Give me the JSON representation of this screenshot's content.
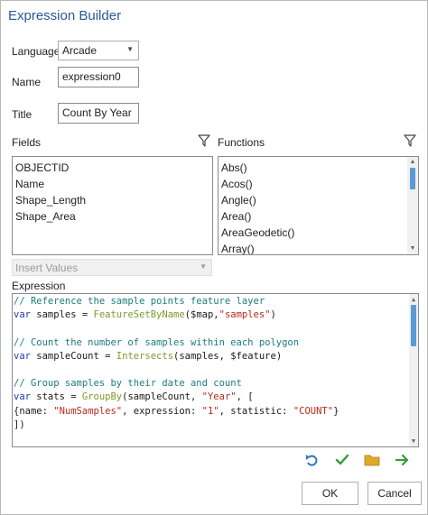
{
  "window": {
    "title": "Expression Builder"
  },
  "form": {
    "language_label": "Language",
    "language_value": "Arcade",
    "name_label": "Name",
    "name_value": "expression0",
    "title_label": "Title",
    "title_value": "Count By Year"
  },
  "fields": {
    "label": "Fields",
    "items": [
      "OBJECTID",
      "Name",
      "Shape_Length",
      "Shape_Area"
    ]
  },
  "functions": {
    "label": "Functions",
    "items": [
      "Abs()",
      "Acos()",
      "Angle()",
      "Area()",
      "AreaGeodetic()",
      "Array()"
    ]
  },
  "insert_values": {
    "label": "Insert Values"
  },
  "expression": {
    "label": "Expression",
    "lines": [
      [
        {
          "t": "// Reference the sample points feature layer",
          "c": "c-com"
        }
      ],
      [
        {
          "t": "var",
          "c": "c-kw"
        },
        {
          "t": " samples = ",
          "c": "c-var"
        },
        {
          "t": "FeatureSetByName",
          "c": "c-fn"
        },
        {
          "t": "(",
          "c": "c-var"
        },
        {
          "t": "$map",
          "c": "c-var"
        },
        {
          "t": ",",
          "c": "c-var"
        },
        {
          "t": "\"samples\"",
          "c": "c-str"
        },
        {
          "t": ")",
          "c": "c-var"
        }
      ],
      [],
      [
        {
          "t": "// Count the number of samples within each polygon",
          "c": "c-com"
        }
      ],
      [
        {
          "t": "var",
          "c": "c-kw"
        },
        {
          "t": " sampleCount = ",
          "c": "c-var"
        },
        {
          "t": "Intersects",
          "c": "c-fn"
        },
        {
          "t": "(samples, ",
          "c": "c-var"
        },
        {
          "t": "$feature",
          "c": "c-var"
        },
        {
          "t": ")",
          "c": "c-var"
        }
      ],
      [],
      [
        {
          "t": "// Group samples by their date and count",
          "c": "c-com"
        }
      ],
      [
        {
          "t": "var",
          "c": "c-kw"
        },
        {
          "t": " stats = ",
          "c": "c-var"
        },
        {
          "t": "GroupBy",
          "c": "c-fn"
        },
        {
          "t": "(sampleCount, ",
          "c": "c-var"
        },
        {
          "t": "\"Year\"",
          "c": "c-str"
        },
        {
          "t": ", [",
          "c": "c-var"
        }
      ],
      [
        {
          "t": "{name: ",
          "c": "c-var"
        },
        {
          "t": "\"NumSamples\"",
          "c": "c-str"
        },
        {
          "t": ", expression: ",
          "c": "c-var"
        },
        {
          "t": "\"1\"",
          "c": "c-str"
        },
        {
          "t": ", statistic: ",
          "c": "c-var"
        },
        {
          "t": "\"COUNT\"",
          "c": "c-str"
        },
        {
          "t": "}",
          "c": "c-var"
        }
      ],
      [
        {
          "t": "])",
          "c": "c-var"
        }
      ]
    ]
  },
  "buttons": {
    "ok": "OK",
    "cancel": "Cancel"
  },
  "toolbar_icons": [
    "undo-icon",
    "check-icon",
    "folder-icon",
    "arrow-right-icon"
  ],
  "colors": {
    "title": "#2b5797",
    "accent": "#5c9ad6",
    "check": "#3a9a3a",
    "folder": "#e0a92a",
    "arrow": "#3a9a3a",
    "undo": "#2a7bc4"
  }
}
